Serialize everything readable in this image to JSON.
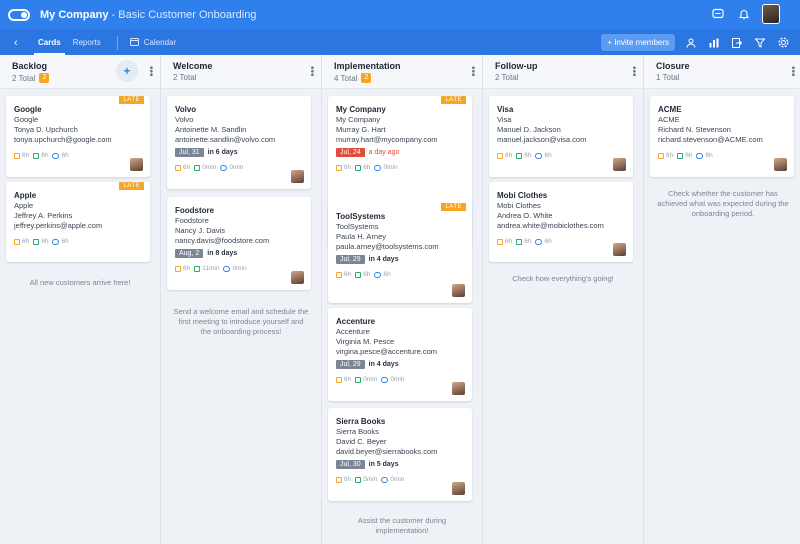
{
  "header": {
    "company": "My Company",
    "separator": " - ",
    "board_name": "Basic Customer Onboarding"
  },
  "nav": {
    "tabs": [
      "Cards",
      "Reports"
    ],
    "calendar": "Calendar",
    "invite": "+ Invite members"
  },
  "columns": [
    {
      "title": "Backlog",
      "total": "2 Total",
      "late_count": "2",
      "note": "All new customers arrive here!",
      "cards": [
        {
          "title": "Google",
          "lines": [
            "Google",
            "Tonya D. Upchurch",
            "tonya.upchurch@google.com"
          ],
          "late": "LATE",
          "due_date": "",
          "due_label": "",
          "overdue": false,
          "meta": [
            "6h",
            "6h",
            "6h"
          ]
        },
        {
          "title": "Apple",
          "lines": [
            "Apple",
            "Jeffrey A. Perkins",
            "jeffrey.perkins@apple.com"
          ],
          "late": "LATE",
          "due_date": "",
          "due_label": "",
          "overdue": false,
          "meta": [
            "6h",
            "6h",
            "6h"
          ]
        }
      ]
    },
    {
      "title": "Welcome",
      "total": "2 Total",
      "late_count": "",
      "note": "Send a welcome email and schedule the first meeting to introduce yourself and the onboarding process!",
      "cards": [
        {
          "title": "Volvo",
          "lines": [
            "Volvo",
            "Antoinette M. Sandlin",
            "antoinette.sandlin@volvo.com"
          ],
          "late": "",
          "due_date": "Jul, 31",
          "due_label": "in 6 days",
          "overdue": false,
          "meta": [
            "6h",
            "0min",
            "0min"
          ]
        },
        {
          "title": "Foodstore",
          "lines": [
            "Foodstore",
            "Nancy J. Davis",
            "nancy.davis@foodstore.com"
          ],
          "late": "",
          "due_date": "Aug, 2",
          "due_label": "in 8 days",
          "overdue": false,
          "meta": [
            "6h",
            "11min",
            "0min"
          ]
        }
      ]
    },
    {
      "title": "Implementation",
      "total": "4 Total",
      "late_count": "2",
      "note": "Assist the customer during implementation!",
      "cards": [
        {
          "title": "My Company",
          "lines": [
            "My Company",
            "Murray G. Hart",
            "murray.hart@mycompany.com"
          ],
          "late": "LATE",
          "due_date": "Jul, 24",
          "due_label": "a day ago",
          "overdue": true,
          "meta": [
            "6h",
            "6h",
            "0min"
          ]
        },
        {
          "title": "ToolSystems",
          "lines": [
            "ToolSystems",
            "Paula H. Arney",
            "paula.arney@toolsystems.com"
          ],
          "late": "LATE",
          "due_date": "Jul, 29",
          "due_label": "in 4 days",
          "overdue": false,
          "meta": [
            "6h",
            "6h",
            "6h"
          ]
        },
        {
          "title": "Accenture",
          "lines": [
            "Accenture",
            "Virginia M. Pesce",
            "virgina.pesce@accenture.com"
          ],
          "late": "",
          "due_date": "Jul, 29",
          "due_label": "in 4 days",
          "overdue": false,
          "meta": [
            "6h",
            "0min",
            "0min"
          ]
        },
        {
          "title": "Sierra Books",
          "lines": [
            "Sierra Books",
            "David C. Beyer",
            "david.beyer@sierrabooks.com"
          ],
          "late": "",
          "due_date": "Jul, 30",
          "due_label": "in 5 days",
          "overdue": false,
          "meta": [
            "6h",
            "5min",
            "0min"
          ]
        }
      ]
    },
    {
      "title": "Follow-up",
      "total": "2 Total",
      "late_count": "",
      "note": "Check how everything's going!",
      "cards": [
        {
          "title": "Visa",
          "lines": [
            "Visa",
            "Manuel D. Jackson",
            "manuel.jackson@visa.com"
          ],
          "late": "",
          "due_date": "",
          "due_label": "",
          "overdue": false,
          "meta": [
            "6h",
            "6h",
            "6h"
          ]
        },
        {
          "title": "Mobi Clothes",
          "lines": [
            "Mobi Clothes",
            "Andrea O. White",
            "andrea.white@mobiclothes.com"
          ],
          "late": "",
          "due_date": "",
          "due_label": "",
          "overdue": false,
          "meta": [
            "6h",
            "6h",
            "6h"
          ]
        }
      ]
    },
    {
      "title": "Closure",
      "total": "1 Total",
      "late_count": "",
      "note": "Check whether the customer has achieved what was expected during the onboarding period.",
      "cards": [
        {
          "title": "ACME",
          "lines": [
            "ACME",
            "Richard N. Stevenson",
            "richard.stevenson@ACME.com"
          ],
          "late": "",
          "due_date": "",
          "due_label": "",
          "overdue": false,
          "meta": [
            "6h",
            "6h",
            "6h"
          ]
        }
      ]
    }
  ]
}
